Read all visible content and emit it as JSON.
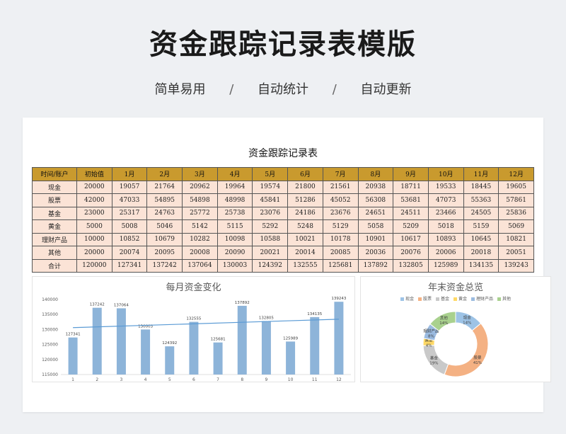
{
  "header": {
    "title": "资金跟踪记录表模版",
    "tags": [
      "简单易用",
      "自动统计",
      "自动更新"
    ],
    "separator": "/"
  },
  "sheet": {
    "title": "资金跟踪记录表",
    "columns": [
      "时间/账户",
      "初始值",
      "1月",
      "2月",
      "3月",
      "4月",
      "5月",
      "6月",
      "7月",
      "8月",
      "9月",
      "10月",
      "11月",
      "12月"
    ],
    "rows": [
      [
        "现金",
        "20000",
        "19057",
        "21764",
        "20962",
        "19964",
        "19574",
        "21800",
        "21561",
        "20938",
        "18711",
        "19533",
        "18445",
        "19605"
      ],
      [
        "股票",
        "42000",
        "47033",
        "54895",
        "54898",
        "48998",
        "45841",
        "51286",
        "45052",
        "56308",
        "53681",
        "47073",
        "55363",
        "57861"
      ],
      [
        "基金",
        "23000",
        "25317",
        "24763",
        "25772",
        "25738",
        "23076",
        "24186",
        "23676",
        "24651",
        "24511",
        "23466",
        "24505",
        "25836"
      ],
      [
        "黄金",
        "5000",
        "5008",
        "5046",
        "5142",
        "5115",
        "5292",
        "5248",
        "5129",
        "5058",
        "5209",
        "5018",
        "5159",
        "5069"
      ],
      [
        "理财产品",
        "10000",
        "10852",
        "10679",
        "10282",
        "10098",
        "10588",
        "10021",
        "10178",
        "10901",
        "10617",
        "10893",
        "10645",
        "10821"
      ],
      [
        "其他",
        "20000",
        "20074",
        "20095",
        "20008",
        "20090",
        "20021",
        "20014",
        "20085",
        "20036",
        "20076",
        "20006",
        "20018",
        "20051"
      ],
      [
        "合计",
        "120000",
        "127341",
        "137242",
        "137064",
        "130003",
        "124392",
        "132555",
        "125681",
        "137892",
        "132805",
        "125989",
        "134135",
        "139243"
      ]
    ]
  },
  "chart_data": [
    {
      "type": "bar",
      "title": "每月资金变化",
      "categories": [
        "1",
        "2",
        "3",
        "4",
        "5",
        "6",
        "7",
        "8",
        "9",
        "10",
        "11",
        "12"
      ],
      "values": [
        127341,
        137242,
        137064,
        130003,
        124392,
        132555,
        125681,
        137892,
        132805,
        125989,
        134135,
        139243
      ],
      "yticks": [
        "140000",
        "135000",
        "130000",
        "125000",
        "120000",
        "115000"
      ],
      "ylim": [
        115000,
        140000
      ],
      "trendline": true,
      "bar_color": "#8db4d9",
      "trend_color": "#5b9bd5"
    },
    {
      "type": "pie",
      "title": "年末资金总览",
      "categories": [
        "现金",
        "股票",
        "基金",
        "黄金",
        "理财产品",
        "其他"
      ],
      "values": [
        19605,
        57861,
        25836,
        5069,
        10821,
        20051
      ],
      "labels": [
        {
          "name": "现金",
          "pct": "14%"
        },
        {
          "name": "股票",
          "pct": "41%"
        },
        {
          "name": "基金",
          "pct": "19%"
        },
        {
          "name": "黄金",
          "pct": "4%"
        },
        {
          "name": "理财产品",
          "pct": "8%"
        },
        {
          "name": "其他",
          "pct": "14%"
        }
      ],
      "colors": [
        "#9dc3e6",
        "#f4b183",
        "#c9c9c9",
        "#ffd966",
        "#9bbbe0",
        "#a9d18e"
      ],
      "legend_position": "top"
    }
  ]
}
